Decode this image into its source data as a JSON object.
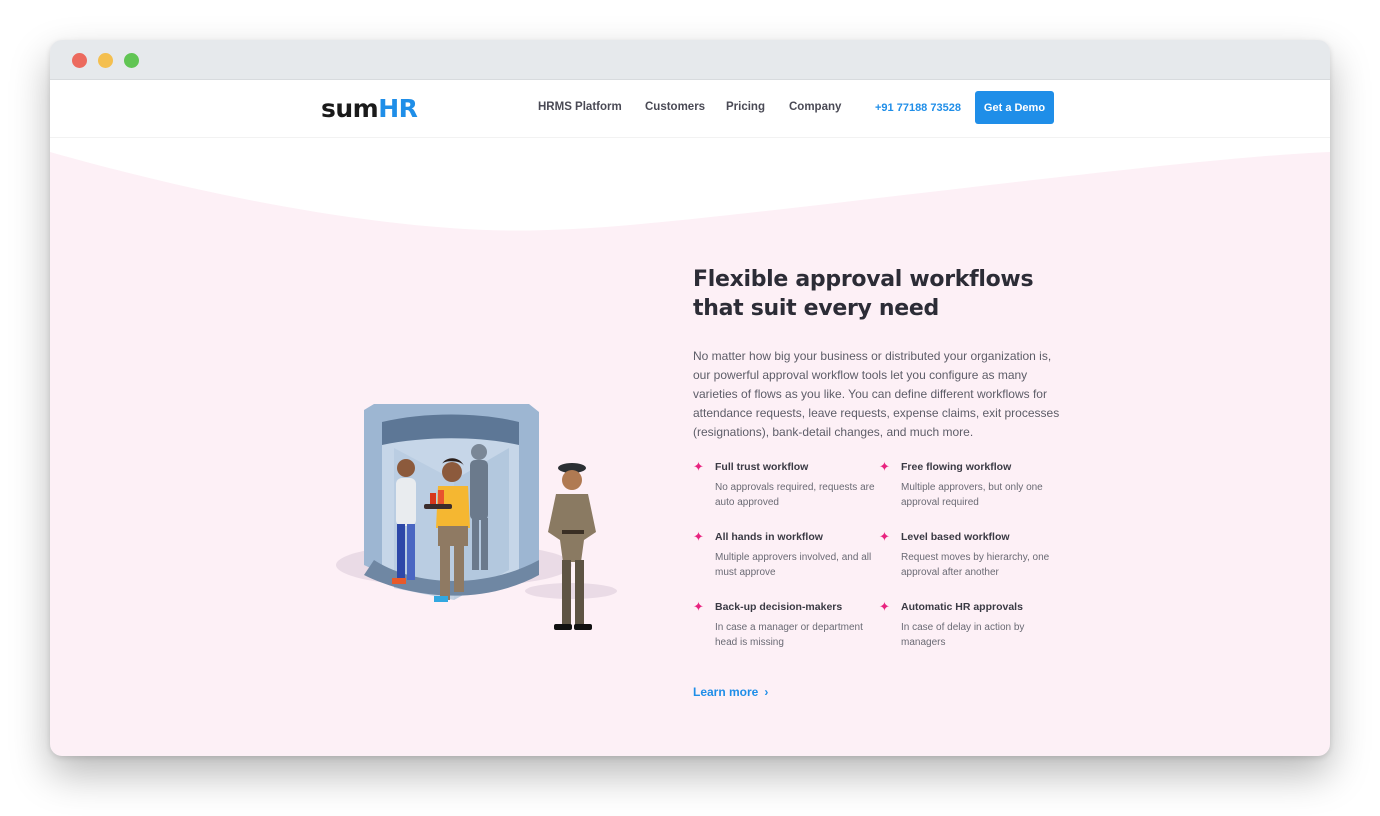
{
  "window": {
    "controls": [
      "close",
      "minimize",
      "zoom"
    ]
  },
  "header": {
    "logo": {
      "part1": "sum",
      "part2": "HR"
    },
    "nav": [
      "HRMS Platform",
      "Customers",
      "Pricing",
      "Company"
    ],
    "phone": "+91 77188 73528",
    "cta": "Get a Demo"
  },
  "hero": {
    "title_line1": "Flexible approval workflows",
    "title_line2": "that suit every need",
    "description": "No matter how big your business or distributed your organization is, our powerful approval workflow tools let you configure as many varieties of flows as you like. You can define different workflows for attendance requests, leave requests, expense claims, exit processes (resignations), bank-detail changes, and much more."
  },
  "features": [
    {
      "title": "Full trust workflow",
      "desc": "No approvals required, requests are auto approved",
      "icon": "sparkle-icon"
    },
    {
      "title": "Free flowing workflow",
      "desc": "Multiple approvers, but only one approval required",
      "icon": "sparkle-icon"
    },
    {
      "title": "All hands in workflow",
      "desc": "Multiple approvers involved, and all must approve",
      "icon": "sparkle-icon"
    },
    {
      "title": "Level based workflow",
      "desc": "Request moves by hierarchy, one approval after another",
      "icon": "sparkle-icon"
    },
    {
      "title": "Back-up decision-makers",
      "desc": "In case a manager or department head is missing",
      "icon": "sparkle-icon"
    },
    {
      "title": "Automatic HR approvals",
      "desc": "In case of delay in action by managers",
      "icon": "sparkle-icon"
    }
  ],
  "cta_link": {
    "label": "Learn more",
    "icon": "chevron-right-icon"
  },
  "colors": {
    "brand_blue": "#1f8ee8",
    "accent_pink": "#e8227f",
    "section_bg": "#fdf0f6"
  }
}
